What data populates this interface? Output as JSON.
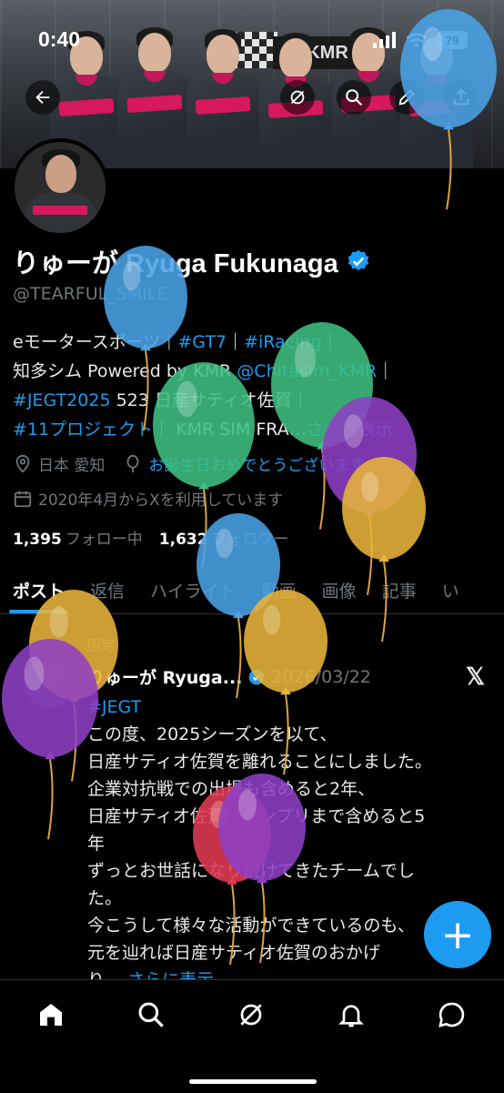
{
  "status_bar": {
    "time": "0:40",
    "battery": "79"
  },
  "header": {
    "sign_text": "KMR"
  },
  "profile": {
    "display_name": "りゅーが Ryuga Fukunaga",
    "handle": "@TEARFUL_SMILE",
    "bio_line1_prefix": "eモータースポーツ｜",
    "bio_tag_gt7": "#GT7",
    "bio_sep1": "｜",
    "bio_tag_iracing": "#iRacing",
    "bio_sep2": "｜",
    "bio_line2_prefix": "知多シム Powered by KMR ",
    "bio_mention": "@Chitasim_KMR",
    "bio_sep3": "｜",
    "bio_tag_jegt": "#JEGT2025",
    "bio_line3_text": " 523 日産サティオ佐賀｜",
    "bio_tag_11": "#11プロジェクト",
    "bio_line4_text": "｜ KMR SIM FRA…",
    "bio_more": "さらに表示",
    "location": "日本 愛知",
    "birthday": "お誕生日おめでとうございます",
    "joined": "2020年4月からXを利用しています",
    "following_count": "1,395",
    "following_label": "フォロー中",
    "followers_count": "1,632",
    "followers_label": "フォロワー"
  },
  "tabs": [
    "ポスト",
    "返信",
    "ハイライト",
    "動画",
    "画像",
    "記事",
    "い"
  ],
  "post": {
    "pinned_label": "固定",
    "author_name": "りゅーが Ryuga...",
    "date": "2026/03/22",
    "hashtag": "#JEGT",
    "lines": [
      "この度、2025シーズンを以て、",
      "日産サティオ佐賀を離れることにしました。",
      "企業対抗戦での出場も含めると2年、",
      "日産サティオ佐賀グランプリまで含めると5",
      "年",
      "ずっとお世話になり続けてきたチームでし",
      "た。",
      "今こうして様々な活動ができているのも、",
      "元を辿れば日産サティオ佐賀のおかげ",
      "り…"
    ],
    "more": "さらに表示"
  },
  "fab_label": "+",
  "colors": {
    "accent": "#1d9bf0",
    "muted": "#71767b",
    "background": "#000000"
  },
  "bottom_nav": [
    "home-icon",
    "search-icon",
    "grok-icon",
    "notifications-icon",
    "messages-icon"
  ],
  "balloon_colors": [
    "#4aa3e6",
    "#3fbf82",
    "#8e3fc4",
    "#e8b43a",
    "#e23a52"
  ]
}
